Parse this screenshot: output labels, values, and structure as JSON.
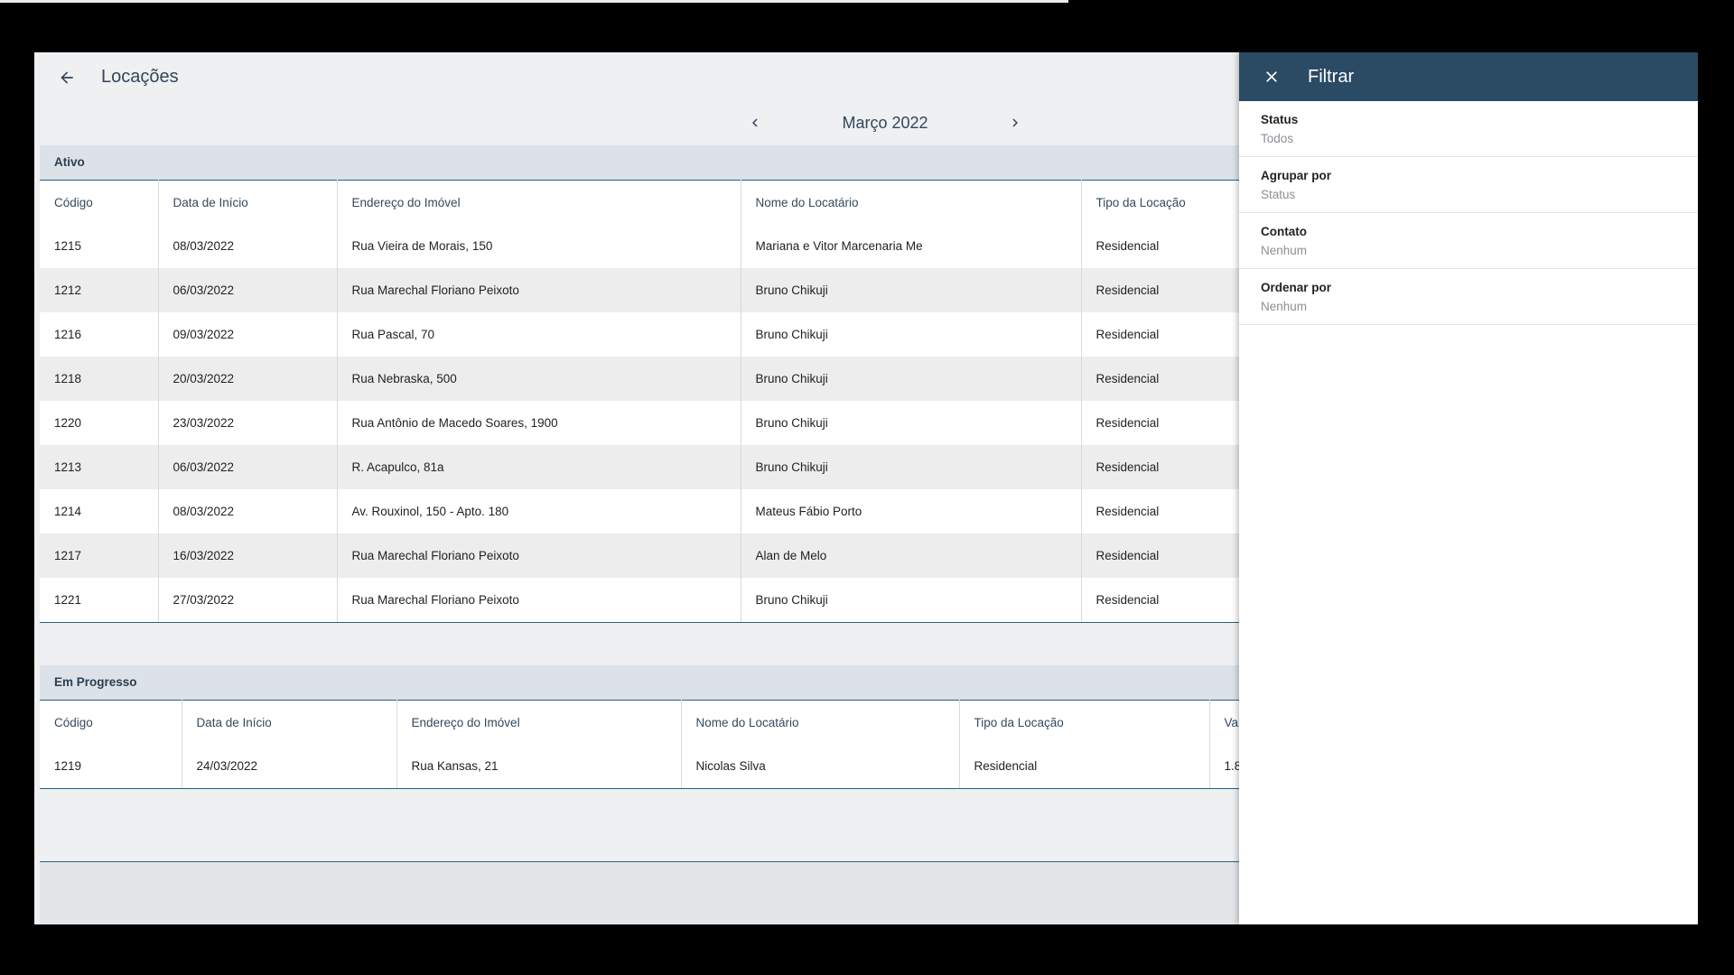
{
  "header": {
    "title": "Locações",
    "back_icon": "arrow-left-icon"
  },
  "month_nav": {
    "label": "Março 2022",
    "prev_icon": "chevron-left-icon",
    "next_icon": "chevron-right-icon"
  },
  "groups": {
    "ativo": {
      "label": "Ativo",
      "columns": [
        "Código",
        "Data de Início",
        "Endereço do Imóvel",
        "Nome do Locatário",
        "Tipo da Locação"
      ],
      "rows": [
        [
          "1215",
          "08/03/2022",
          "Rua Vieira de Morais, 150",
          "Mariana e Vitor Marcenaria Me",
          "Residencial"
        ],
        [
          "1212",
          "06/03/2022",
          "Rua Marechal Floriano Peixoto",
          "Bruno Chikuji",
          "Residencial"
        ],
        [
          "1216",
          "09/03/2022",
          "Rua Pascal, 70",
          "Bruno Chikuji",
          "Residencial"
        ],
        [
          "1218",
          "20/03/2022",
          "Rua Nebraska, 500",
          "Bruno Chikuji",
          "Residencial"
        ],
        [
          "1220",
          "23/03/2022",
          "Rua Antônio de Macedo Soares, 1900",
          "Bruno Chikuji",
          "Residencial"
        ],
        [
          "1213",
          "06/03/2022",
          "R. Acapulco, 81a",
          "Bruno Chikuji",
          "Residencial"
        ],
        [
          "1214",
          "08/03/2022",
          "Av. Rouxinol, 150 - Apto. 180",
          "Mateus Fábio Porto",
          "Residencial"
        ],
        [
          "1217",
          "16/03/2022",
          "Rua Marechal Floriano Peixoto",
          "Alan de Melo",
          "Residencial"
        ],
        [
          "1221",
          "27/03/2022",
          "Rua Marechal Floriano Peixoto",
          "Bruno Chikuji",
          "Residencial"
        ]
      ]
    },
    "em_progresso": {
      "label": "Em Progresso",
      "columns": [
        "Código",
        "Data de Início",
        "Endereço do Imóvel",
        "Nome do Locatário",
        "Tipo da Locação",
        "Val"
      ],
      "rows": [
        [
          "1219",
          "24/03/2022",
          "Rua Kansas, 21",
          "Nicolas Silva",
          "Residencial",
          "1.8"
        ]
      ]
    }
  },
  "filter_drawer": {
    "title": "Filtrar",
    "close_icon": "close-icon",
    "items": [
      {
        "label": "Status",
        "value": "Todos"
      },
      {
        "label": "Agrupar por",
        "value": "Status"
      },
      {
        "label": "Contato",
        "value": "Nenhum"
      },
      {
        "label": "Ordenar por",
        "value": "Nenhum"
      }
    ]
  },
  "colors": {
    "accent": "#2c5f7c",
    "drawer_header": "#2b4a63",
    "group_header": "#dce2e8"
  }
}
